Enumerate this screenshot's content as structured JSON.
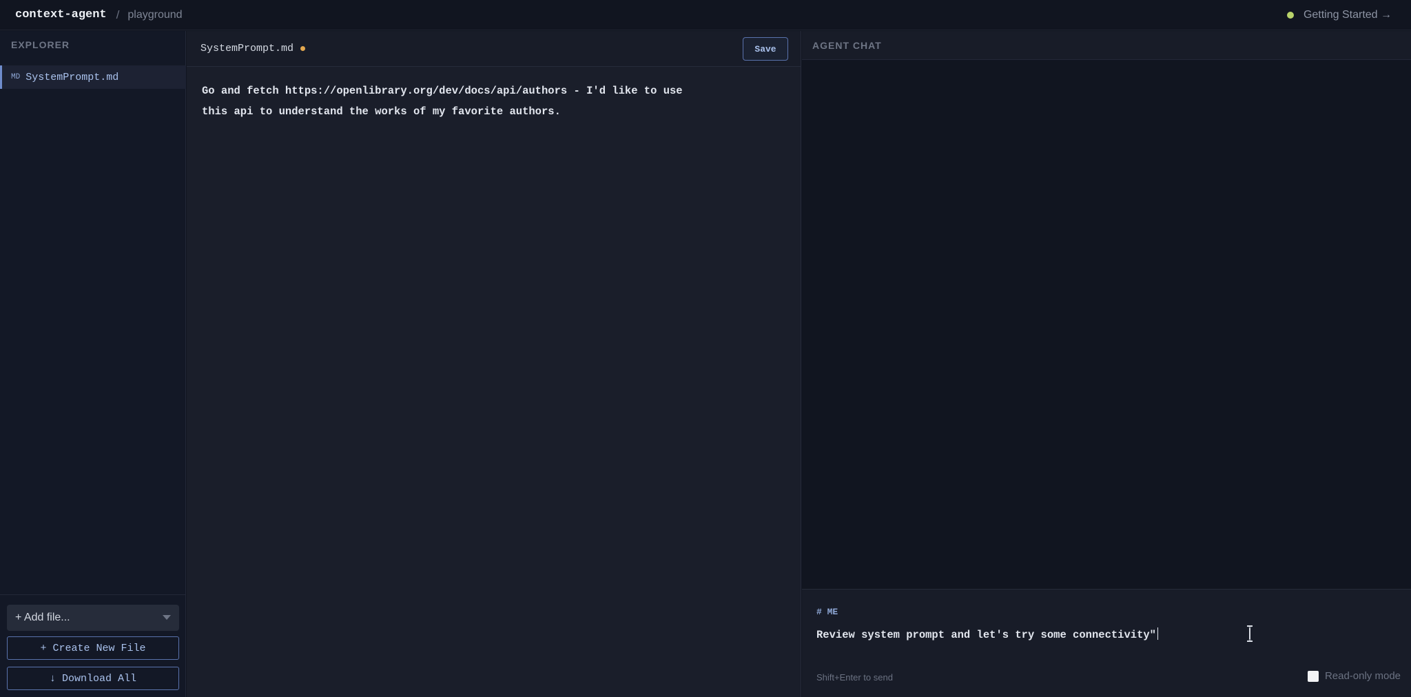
{
  "app": {
    "brand": "context-agent",
    "separator": "/",
    "breadcrumb": "playground",
    "getting_started": "Getting Started →",
    "status_color": "#b9d36a"
  },
  "explorer": {
    "title": "EXPLORER",
    "files": [
      {
        "type": "MD",
        "name": "SystemPrompt.md"
      }
    ],
    "add_file_label": "+ Add file...",
    "create_label": "+ Create New File",
    "download_label": "↓ Download All"
  },
  "editor": {
    "tab_title": "SystemPrompt.md",
    "save_label": "Save",
    "content": "Go and fetch https://openlibrary.org/dev/docs/api/authors - I'd like to use\nthis api to understand the works of my favorite authors."
  },
  "chat": {
    "title": "AGENT CHAT",
    "composer": {
      "author_label": "# ME",
      "value": "Review system prompt and let's try some connectivity\"",
      "hint": "Shift+Enter to send",
      "readonly_label": "Read-only mode"
    }
  }
}
